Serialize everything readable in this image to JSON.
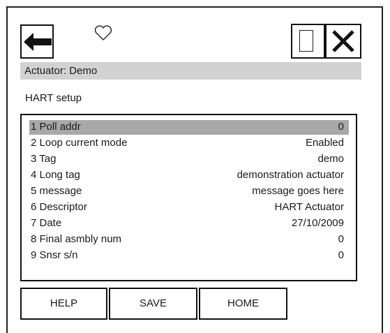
{
  "toolbar": {
    "back_icon": "left-arrow-icon",
    "favorite_icon": "heart-outline-icon",
    "square_icon": "square-outline-icon",
    "close_icon": "close-x-icon"
  },
  "header": {
    "actuator_label": "Actuator: Demo"
  },
  "section": {
    "title": "HART setup"
  },
  "list": {
    "rows": [
      {
        "label": "1 Poll addr",
        "value": "0"
      },
      {
        "label": "2 Loop current mode",
        "value": "Enabled"
      },
      {
        "label": "3 Tag",
        "value": "demo"
      },
      {
        "label": "4 Long tag",
        "value": "demonstration actuator"
      },
      {
        "label": "5 message",
        "value": "message goes here"
      },
      {
        "label": "6 Descriptor",
        "value": "HART Actuator"
      },
      {
        "label": "7 Date",
        "value": "27/10/2009"
      },
      {
        "label": "8 Final asmbly num",
        "value": "0"
      },
      {
        "label": "9 Snsr s/n",
        "value": "0"
      }
    ],
    "selected_index": 0
  },
  "buttons": {
    "help": "HELP",
    "save": "SAVE",
    "home": "HOME"
  },
  "colors": {
    "header_bar": "#d2d2d2",
    "selected_row": "#a8a8a8"
  }
}
